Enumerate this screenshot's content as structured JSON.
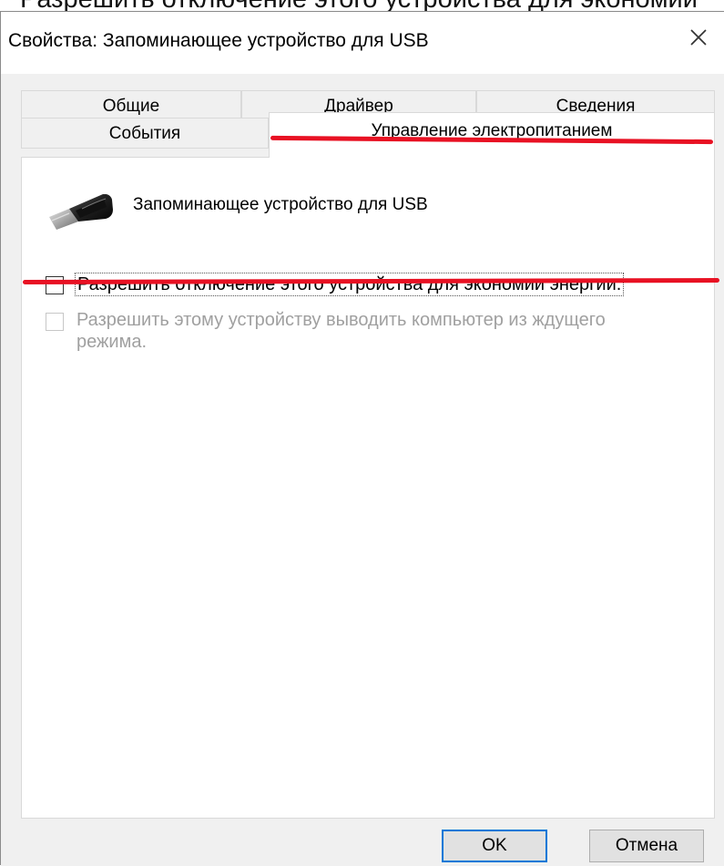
{
  "top_snippet": "Разрешить отключение этого устройства для экономии",
  "dialog": {
    "title": "Свойства: Запоминающее устройство для USB",
    "close_icon": "close-icon"
  },
  "tabs": {
    "general": "Общие",
    "driver": "Драйвер",
    "details": "Сведения",
    "events": "События",
    "power": "Управление электропитанием",
    "active": "power"
  },
  "device": {
    "icon": "usb-plug-icon",
    "name": "Запоминающее устройство для USB"
  },
  "options": {
    "allow_power_off": {
      "label": "Разрешить отключение этого устройства для экономии энергии.",
      "checked": false,
      "enabled": true
    },
    "allow_wake": {
      "label": "Разрешить этому устройству выводить компьютер из ждущего режима.",
      "checked": false,
      "enabled": false
    }
  },
  "buttons": {
    "ok": "OK",
    "cancel": "Отмена"
  },
  "colors": {
    "annotation": "#e81123",
    "focus_blue": "#0078d7",
    "dialog_background": "#f0f0f0",
    "panel_background": "#ffffff"
  }
}
